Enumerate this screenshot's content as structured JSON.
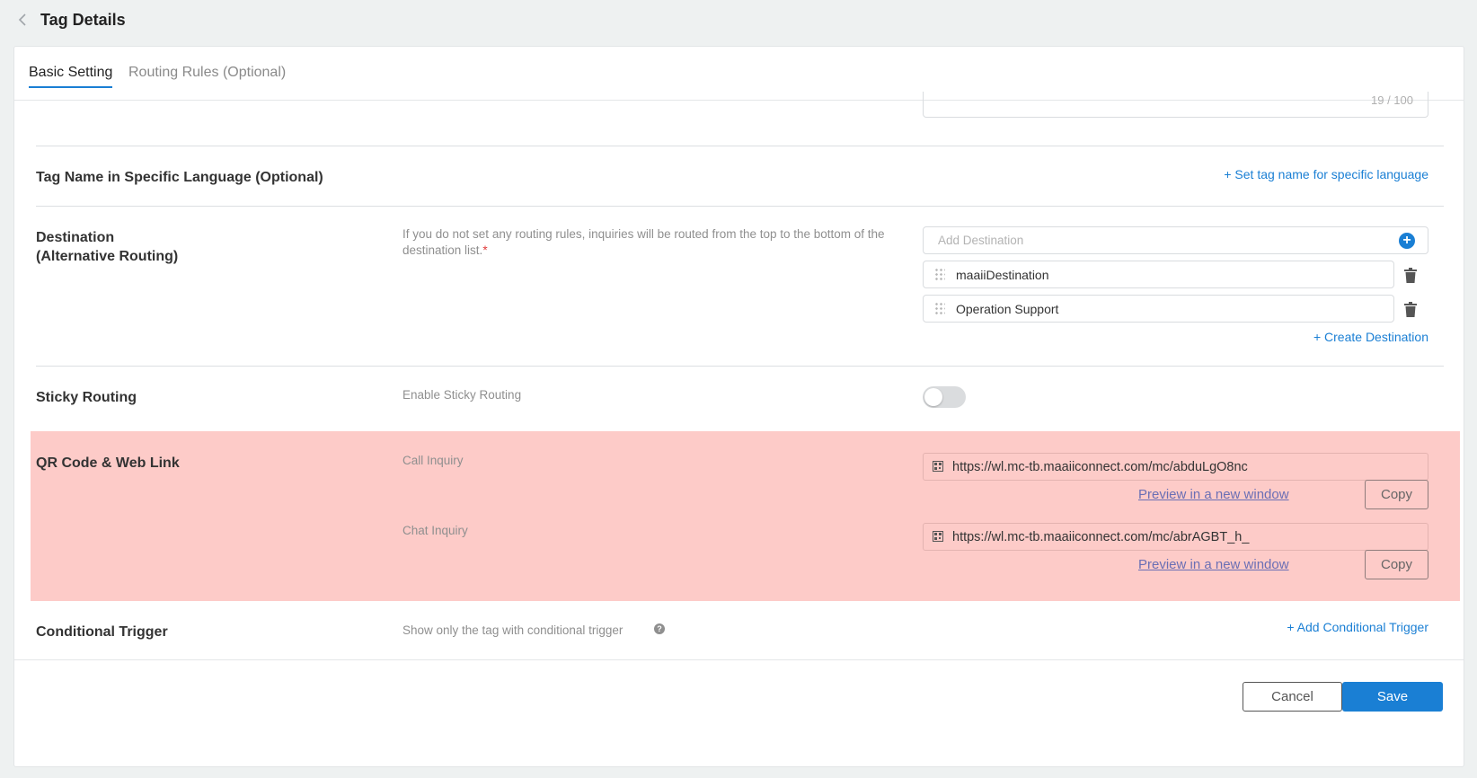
{
  "header": {
    "title": "Tag Details",
    "back_icon": "chevron-left-icon"
  },
  "tabs": [
    {
      "label": "Basic Setting",
      "active": true
    },
    {
      "label": "Routing Rules (Optional)",
      "active": false
    }
  ],
  "description_field": {
    "char_count": "19 / 100"
  },
  "tag_name_language": {
    "label": "Tag Name in Specific Language (Optional)",
    "link": "+ Set tag name for specific language"
  },
  "destination": {
    "label_line1": "Destination",
    "label_line2": "(Alternative Routing)",
    "description": "If you do not set any routing rules, inquiries will be routed from the top to the bottom of the destination list.",
    "required_mark": "*",
    "placeholder": "Add Destination",
    "items": [
      {
        "name": "maaiiDestination"
      },
      {
        "name": "Operation Support"
      }
    ],
    "create_link": "+ Create Destination"
  },
  "sticky_routing": {
    "label": "Sticky Routing",
    "description": "Enable Sticky Routing",
    "enabled": false
  },
  "qr_code": {
    "label": "QR Code & Web Link",
    "highlight_color": "#fdcbc8",
    "call": {
      "label": "Call Inquiry",
      "url": "https://wl.mc-tb.maaiiconnect.com/mc/abduLgO8nc",
      "preview": "Preview in a new window",
      "copy": "Copy"
    },
    "chat": {
      "label": "Chat Inquiry",
      "url": "https://wl.mc-tb.maaiiconnect.com/mc/abrAGBT_h_",
      "preview": "Preview in a new window",
      "copy": "Copy"
    }
  },
  "conditional_trigger": {
    "label": "Conditional Trigger",
    "description": "Show only the tag with conditional trigger",
    "help_icon": "?",
    "link": "+ Add Conditional Trigger"
  },
  "footer": {
    "cancel": "Cancel",
    "save": "Save"
  },
  "colors": {
    "accent": "#1a7fd4",
    "highlight": "#fdcbc8"
  }
}
